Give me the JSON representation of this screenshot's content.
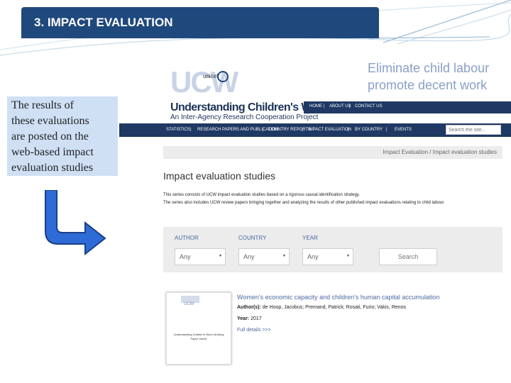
{
  "slide": {
    "title": "3. IMPACT EVALUATION",
    "note_lines": [
      "The results of",
      "these evaluations",
      "are  posted on the",
      "web-based impact",
      "evaluation studies"
    ]
  },
  "site": {
    "logo_letters": "UCW",
    "unicef_text": "unicef",
    "name": "Understanding Children's Work",
    "subtitle": "An Inter-Agency Research Cooperation Project",
    "tagline_line1": "Eliminate child labour",
    "tagline_line2": "promote decent work",
    "topnav": [
      "HOME",
      "|",
      "ABOUT US",
      "|",
      "CONTACT US"
    ],
    "mainnav": [
      "STATISTICS",
      "|",
      "RESEARCH PAPERS AND PUBLICATION",
      "|",
      "COUNTRY REPORTS",
      "|",
      "IMPACT EVALUATION",
      "|",
      "BY COUNTRY",
      "|",
      "EVENTS"
    ],
    "search_placeholder": "Search the site...",
    "breadcrumb": "Impact Evaluation  /  Impact evaluation studies",
    "page_title": "Impact evaluation studies",
    "desc_line1": "This series consists of UCW impact evaluation studies based on a rigorous causal identification strategy.",
    "desc_line2": "The series also includes UCW review papers bringing together and analyzing the results of other published impact evaluations relating to child labour.",
    "filters": {
      "author_label": "AUTHOR",
      "country_label": "COUNTRY",
      "year_label": "YEAR",
      "author_value": "Any",
      "country_value": "Any",
      "year_value": "Any",
      "search_button": "Search"
    },
    "result": {
      "thumb_logo": "UCW",
      "thumb_title": "Understanding Children's Work Working Paper Series",
      "title": "Women's economic capacity and children's human capital accumulation",
      "authors_label": "Author(s):",
      "authors": "de Hoop, Jacobus; Premand, Patrick; Rosati, Furio; Vakis, Renos",
      "year_label": "Year:",
      "year": "2017",
      "link": "Full details >>>"
    }
  },
  "colors": {
    "title_bar": "#1f497d",
    "note_bg": "#cfe0f5",
    "arrow": "#2e6bd6",
    "nav": "#1f3864"
  }
}
